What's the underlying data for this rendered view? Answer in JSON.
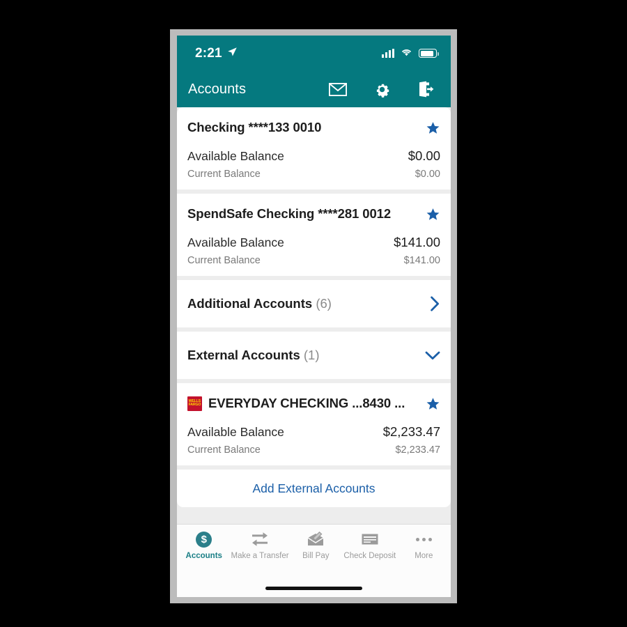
{
  "theme": {
    "header_teal": "#05797f",
    "accent_blue": "#1b5fa8",
    "tab_active_teal": "#1b7f86",
    "page_bg": "#ededed",
    "wells_fargo_red": "#c3122d",
    "wells_fargo_yellow": "#ffd200"
  },
  "status_bar": {
    "time": "2:21",
    "location_icon": "location-arrow-icon",
    "signal_icon": "cellular-signal-icon",
    "wifi_icon": "wifi-icon",
    "battery_icon": "battery-icon"
  },
  "header": {
    "title": "Accounts",
    "actions": [
      {
        "name": "messages-icon",
        "icon": "envelope-icon"
      },
      {
        "name": "settings-icon",
        "icon": "gear-icon"
      },
      {
        "name": "logout-icon",
        "icon": "sign-out-icon"
      }
    ]
  },
  "accounts": [
    {
      "name": "Checking ****133 0010",
      "favorite": true,
      "available_label": "Available Balance",
      "available_value": "$0.00",
      "current_label": "Current Balance",
      "current_value": "$0.00",
      "logo": null
    },
    {
      "name": "SpendSafe Checking ****281 0012",
      "favorite": true,
      "available_label": "Available Balance",
      "available_value": "$141.00",
      "current_label": "Current Balance",
      "current_value": "$141.00",
      "logo": null
    }
  ],
  "additional_accounts": {
    "label": "Additional Accounts",
    "count": "(6)",
    "chevron": "chevron-right-icon"
  },
  "external_accounts": {
    "label": "External Accounts",
    "count": "(1)",
    "chevron": "chevron-down-icon",
    "expanded": true
  },
  "external_account": {
    "name": "EVERYDAY CHECKING ...8430 ...",
    "favorite": true,
    "available_label": "Available Balance",
    "available_value": "$2,233.47",
    "current_label": "Current Balance",
    "current_value": "$2,233.47",
    "logo": {
      "name": "wells-fargo-logo",
      "line1": "WELLS",
      "line2": "FARGO"
    }
  },
  "add_external": {
    "label": "Add External Accounts"
  },
  "tab_bar": {
    "tabs": [
      {
        "label": "Accounts",
        "icon": "dollar-circle-icon",
        "active": true
      },
      {
        "label": "Make a Transfer",
        "icon": "transfer-arrows-icon",
        "active": false
      },
      {
        "label": "Bill Pay",
        "icon": "envelope-pen-icon",
        "active": false
      },
      {
        "label": "Check Deposit",
        "icon": "check-icon",
        "active": false
      },
      {
        "label": "More",
        "icon": "ellipsis-icon",
        "active": false
      }
    ]
  }
}
